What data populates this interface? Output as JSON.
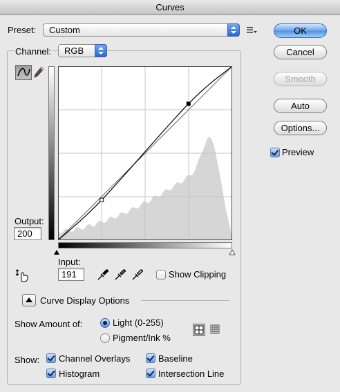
{
  "window": {
    "title": "Curves"
  },
  "preset": {
    "label": "Preset:",
    "value": "Custom"
  },
  "buttons": {
    "ok": "OK",
    "cancel": "Cancel",
    "smooth": "Smooth",
    "auto": "Auto",
    "options": "Options..."
  },
  "preview": {
    "label": "Preview",
    "checked": true
  },
  "channel": {
    "label": "Channel:",
    "value": "RGB"
  },
  "output": {
    "label": "Output:",
    "value": "200"
  },
  "input": {
    "label": "Input:",
    "value": "191"
  },
  "show_clipping": {
    "label": "Show Clipping",
    "checked": false
  },
  "curve_display_options": {
    "label": "Curve Display Options"
  },
  "show_amount": {
    "label": "Show Amount of:",
    "options": [
      {
        "label": "Light  (0-255)",
        "selected": true
      },
      {
        "label": "Pigment/Ink %",
        "selected": false
      }
    ]
  },
  "show": {
    "label": "Show:",
    "options": [
      {
        "label": "Channel Overlays",
        "checked": true
      },
      {
        "label": "Baseline",
        "checked": true
      },
      {
        "label": "Histogram",
        "checked": true
      },
      {
        "label": "Intersection Line",
        "checked": true
      }
    ]
  },
  "curve_points": [
    [
      0,
      0
    ],
    [
      64,
      59
    ],
    [
      191,
      200
    ],
    [
      255,
      255
    ]
  ],
  "colors": {
    "accent": "#3b7be0",
    "histogram": "#d6d6d6"
  },
  "icons": {
    "curve_tool": "curve-icon",
    "pencil_tool": "pencil-icon",
    "presets_menu": "presets-menu-icon",
    "adjust": "on-image-adjust-icon",
    "eyedroppers": [
      "black-eyedropper-icon",
      "gray-eyedropper-icon",
      "white-eyedropper-icon"
    ]
  }
}
